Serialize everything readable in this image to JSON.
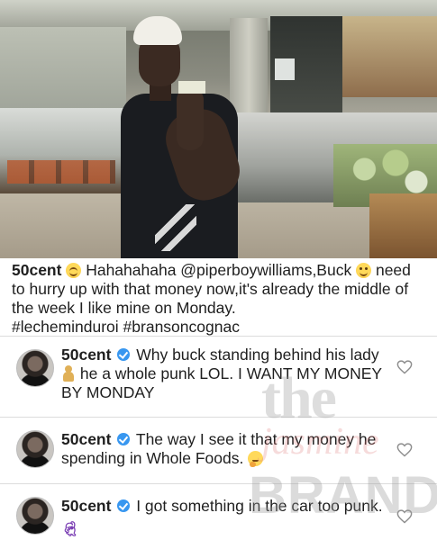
{
  "photo": {
    "description_icon": "photo-image"
  },
  "caption": {
    "username": "50cent",
    "segments": [
      "Hahahahaha @piperboywilliams,Buck",
      "need to hurry up with that money now,it's already the middle of the week I like mine on Monday.",
      "#lecheminduroi #bransoncognac"
    ]
  },
  "comments": [
    {
      "username": "50cent",
      "text_a": "Why buck standing behind his lady",
      "text_b": "he a whole punk LOL. I WANT MY MONEY BY MONDAY"
    },
    {
      "username": "50cent",
      "text_a": "The way I see it that my money he spending in Whole Foods."
    },
    {
      "username": "50cent",
      "text_a": "I got something in the car too punk."
    }
  ],
  "watermark": {
    "line1": "the",
    "line2": "jasmine",
    "line3": "BRAND"
  },
  "colors": {
    "verified": "#3897f0",
    "divider": "#dcdcdc",
    "text": "#1f1f1f"
  }
}
